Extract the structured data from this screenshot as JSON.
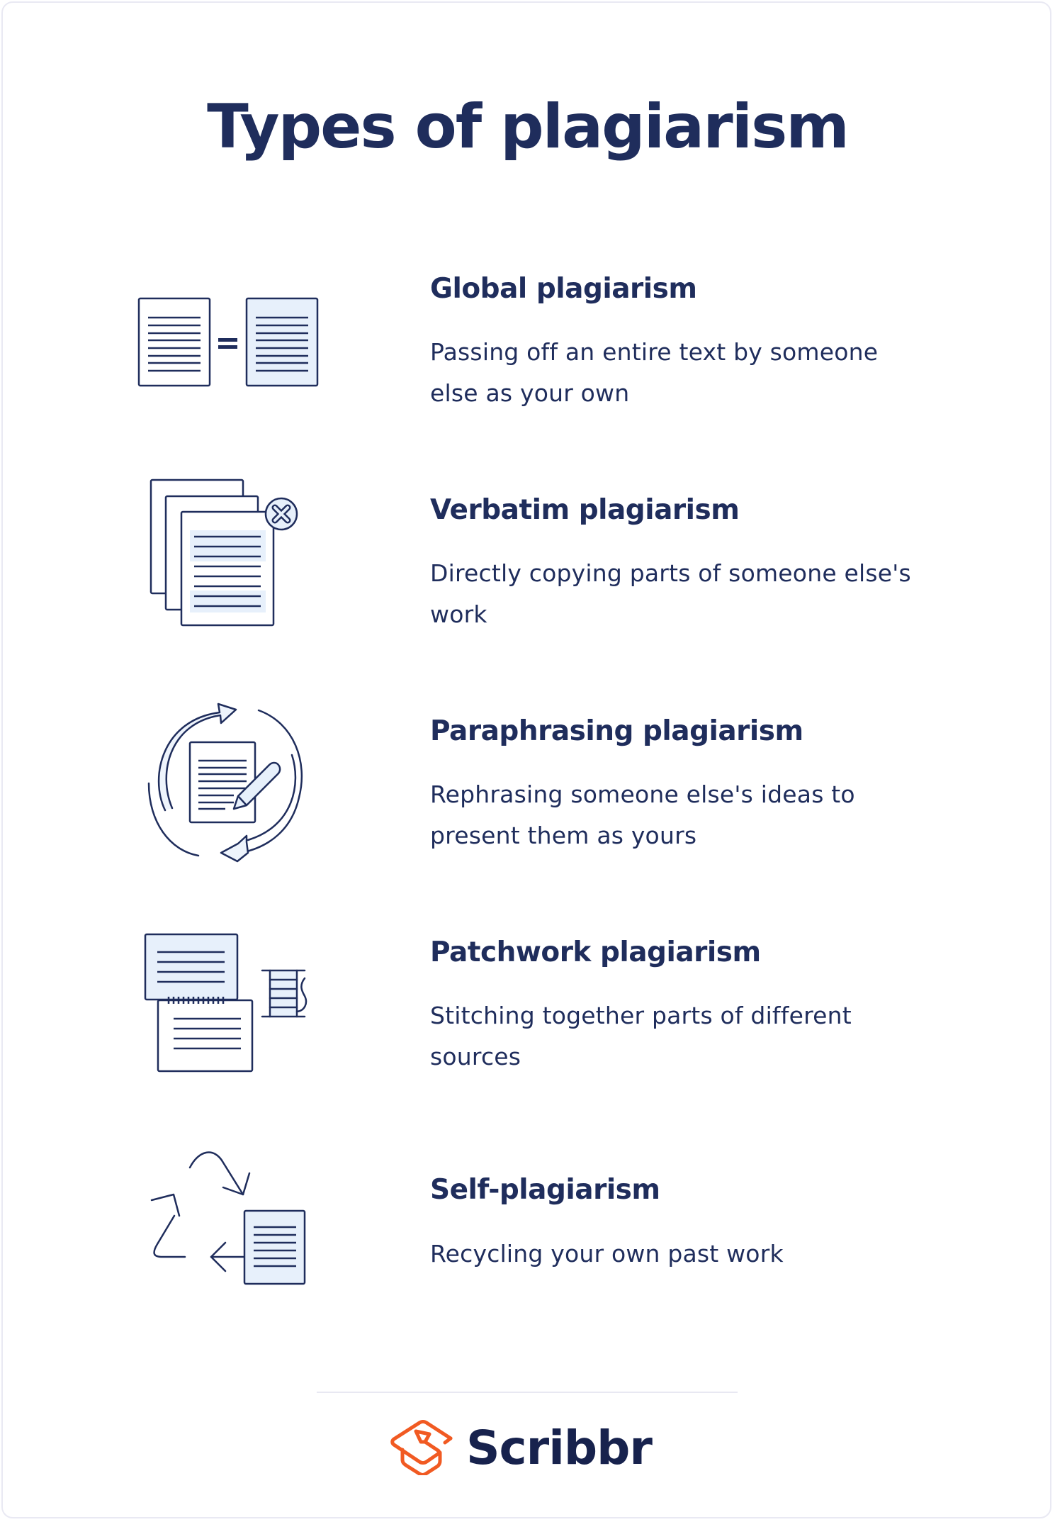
{
  "page": {
    "title": "Types of plagiarism"
  },
  "colors": {
    "ink": "#1f2d5c",
    "fill": "#e7f0fb",
    "brand_orange": "#f15a22",
    "brand_navy": "#17224d"
  },
  "items": [
    {
      "icon": "document-equals-document-icon",
      "heading": "Global plagiarism",
      "description": "Passing off an entire text by someone else as your own"
    },
    {
      "icon": "copied-documents-x-icon",
      "heading": "Verbatim plagiarism",
      "description": "Directly copying parts of someone else's work"
    },
    {
      "icon": "document-pencil-cycle-icon",
      "heading": "Paraphrasing plagiarism",
      "description": "Rephrasing someone else's ideas to present them as yours"
    },
    {
      "icon": "stitched-documents-thread-icon",
      "heading": "Patchwork plagiarism",
      "description": "Stitching together parts of different sources"
    },
    {
      "icon": "recycle-document-icon",
      "heading": "Self-plagiarism",
      "description": "Recycling your own past work"
    }
  ],
  "footer": {
    "brand": "Scribbr",
    "logo_icon": "graduation-cap-icon"
  }
}
